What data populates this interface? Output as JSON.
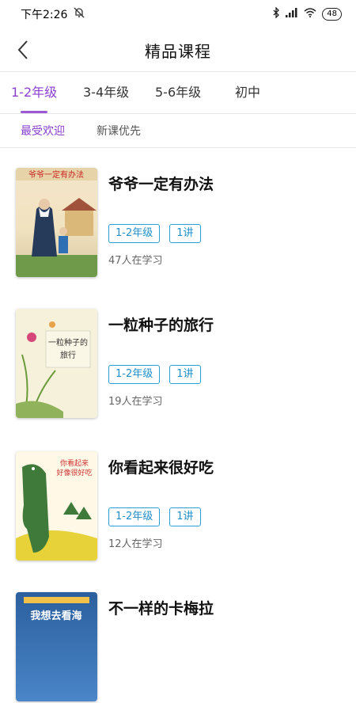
{
  "status": {
    "time": "下午2:26",
    "battery": "48"
  },
  "header": {
    "title": "精品课程"
  },
  "grades": [
    {
      "label": "1-2年级",
      "active": true
    },
    {
      "label": "3-4年级",
      "active": false
    },
    {
      "label": "5-6年级",
      "active": false
    },
    {
      "label": "初中",
      "active": false
    }
  ],
  "sorts": [
    {
      "label": "最受欢迎",
      "active": true
    },
    {
      "label": "新课优先",
      "active": false
    }
  ],
  "courses": [
    {
      "title": "爷爷一定有办法",
      "grade": "1-2年级",
      "lessons": "1讲",
      "learners": "47人在学习",
      "cover_text": "爷爷一定有办法"
    },
    {
      "title": "一粒种子的旅行",
      "grade": "1-2年级",
      "lessons": "1讲",
      "learners": "19人在学习",
      "cover_text": "一粒种子的旅行"
    },
    {
      "title": "你看起来很好吃",
      "grade": "1-2年级",
      "lessons": "1讲",
      "learners": "12人在学习",
      "cover_text": "你看起来好像很好吃"
    },
    {
      "title": "不一样的卡梅拉",
      "grade": "",
      "lessons": "",
      "learners": "",
      "cover_text": "我想去看海"
    }
  ],
  "colors": {
    "accent": "#8a3fd0",
    "tag": "#2aa0d8"
  }
}
